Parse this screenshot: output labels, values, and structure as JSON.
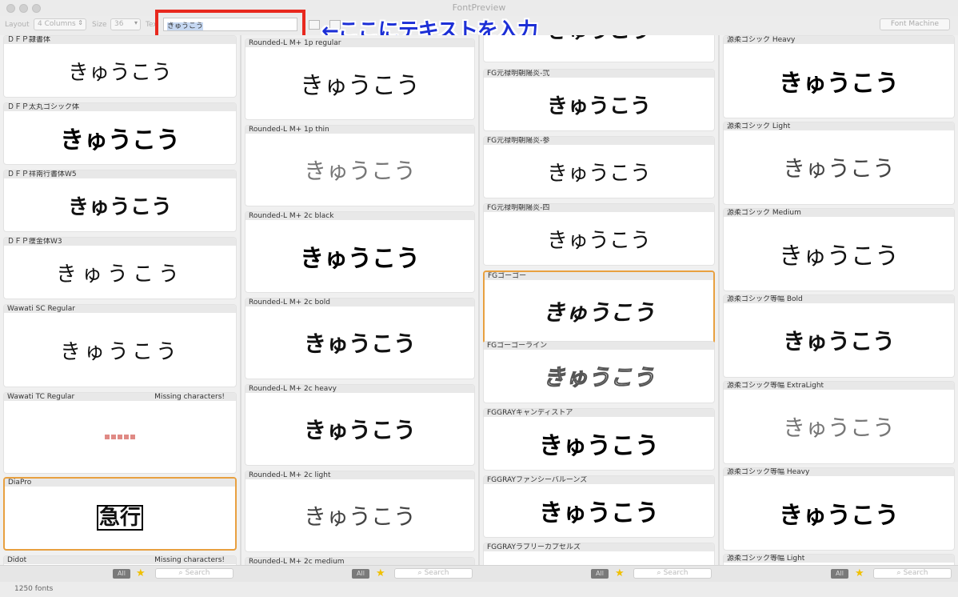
{
  "window": {
    "title": "FontPreview"
  },
  "toolbar": {
    "layout_label": "Layout",
    "layout_value": "4 Columns",
    "size_label": "Size",
    "size_value": "36",
    "text_label": "Tex",
    "text_value": "きゅうこう",
    "font_machine": "Font Machine"
  },
  "annotation": {
    "text": "←ここにテキストを入力",
    "color": "#1c2fd6",
    "box_color": "#e8281e"
  },
  "sample_text": "きゅうこう",
  "columns": [
    {
      "cells": [
        {
          "name": "ＤＦＰ隷書体",
          "sample": "きゅうこう",
          "missing": ""
        },
        {
          "name": "ＤＦＰ太丸ゴシック体",
          "sample": "きゅうこう",
          "missing": ""
        },
        {
          "name": "ＤＦＰ祥南行書体W5",
          "sample": "きゅうこう",
          "missing": ""
        },
        {
          "name": "ＤＦＰ痩金体W3",
          "sample": "きゅうこう",
          "missing": ""
        },
        {
          "name": "Wawati SC Regular",
          "sample": "きゅうこう",
          "missing": ""
        },
        {
          "name": "Wawati TC Regular",
          "sample": "",
          "missing": "Missing characters!"
        },
        {
          "name": "DiaPro",
          "sample": "急行",
          "missing": ""
        },
        {
          "name": "Didot",
          "sample": "",
          "missing": "Missing characters!"
        }
      ]
    },
    {
      "cells": [
        {
          "name": "Rounded-L M+ 1p regular",
          "sample": "きゅうこう"
        },
        {
          "name": "Rounded-L M+ 1p thin",
          "sample": "きゅうこう"
        },
        {
          "name": "Rounded-L M+ 2c black",
          "sample": "きゅうこう"
        },
        {
          "name": "Rounded-L M+ 2c bold",
          "sample": "きゅうこう"
        },
        {
          "name": "Rounded-L M+ 2c heavy",
          "sample": "きゅうこう"
        },
        {
          "name": "Rounded-L M+ 2c light",
          "sample": "きゅうこう"
        },
        {
          "name": "Rounded-L M+ 2c medium",
          "sample": ""
        }
      ]
    },
    {
      "cells": [
        {
          "name": "",
          "sample": "きゅうこう"
        },
        {
          "name": "FG元禄明朝陽炎-弐",
          "sample": "きゅうこう"
        },
        {
          "name": "FG元禄明朝陽炎-参",
          "sample": "きゅうこう"
        },
        {
          "name": "FG元禄明朝陽炎-四",
          "sample": "きゅうこう"
        },
        {
          "name": "FGゴーゴー",
          "sample": "きゅうこう"
        },
        {
          "name": "FGゴーゴーライン",
          "sample": "きゅうこう"
        },
        {
          "name": "FGGRAYキャンディストア",
          "sample": "きゅうこう"
        },
        {
          "name": "FGGRAYファンシーバルーンズ",
          "sample": "きゅうこう"
        },
        {
          "name": "FGGRAYラブリーカプセルズ",
          "sample": ""
        }
      ]
    },
    {
      "cells": [
        {
          "name": "源柔ゴシック Heavy",
          "sample": "きゅうこう"
        },
        {
          "name": "源柔ゴシック Light",
          "sample": "きゅうこう"
        },
        {
          "name": "源柔ゴシック Medium",
          "sample": "きゅうこう"
        },
        {
          "name": "源柔ゴシック等幅 Bold",
          "sample": "きゅうこう"
        },
        {
          "name": "源柔ゴシック等幅 ExtraLight",
          "sample": "きゅうこう"
        },
        {
          "name": "源柔ゴシック等幅 Heavy",
          "sample": "きゅうこう"
        },
        {
          "name": "源柔ゴシック等幅 Light",
          "sample": ""
        }
      ]
    }
  ],
  "bottom": {
    "all_label": "All",
    "search_placeholder": "Search"
  },
  "status": {
    "count": "1250 fonts"
  },
  "icons": {
    "star": "star-icon",
    "search": "search-icon"
  }
}
